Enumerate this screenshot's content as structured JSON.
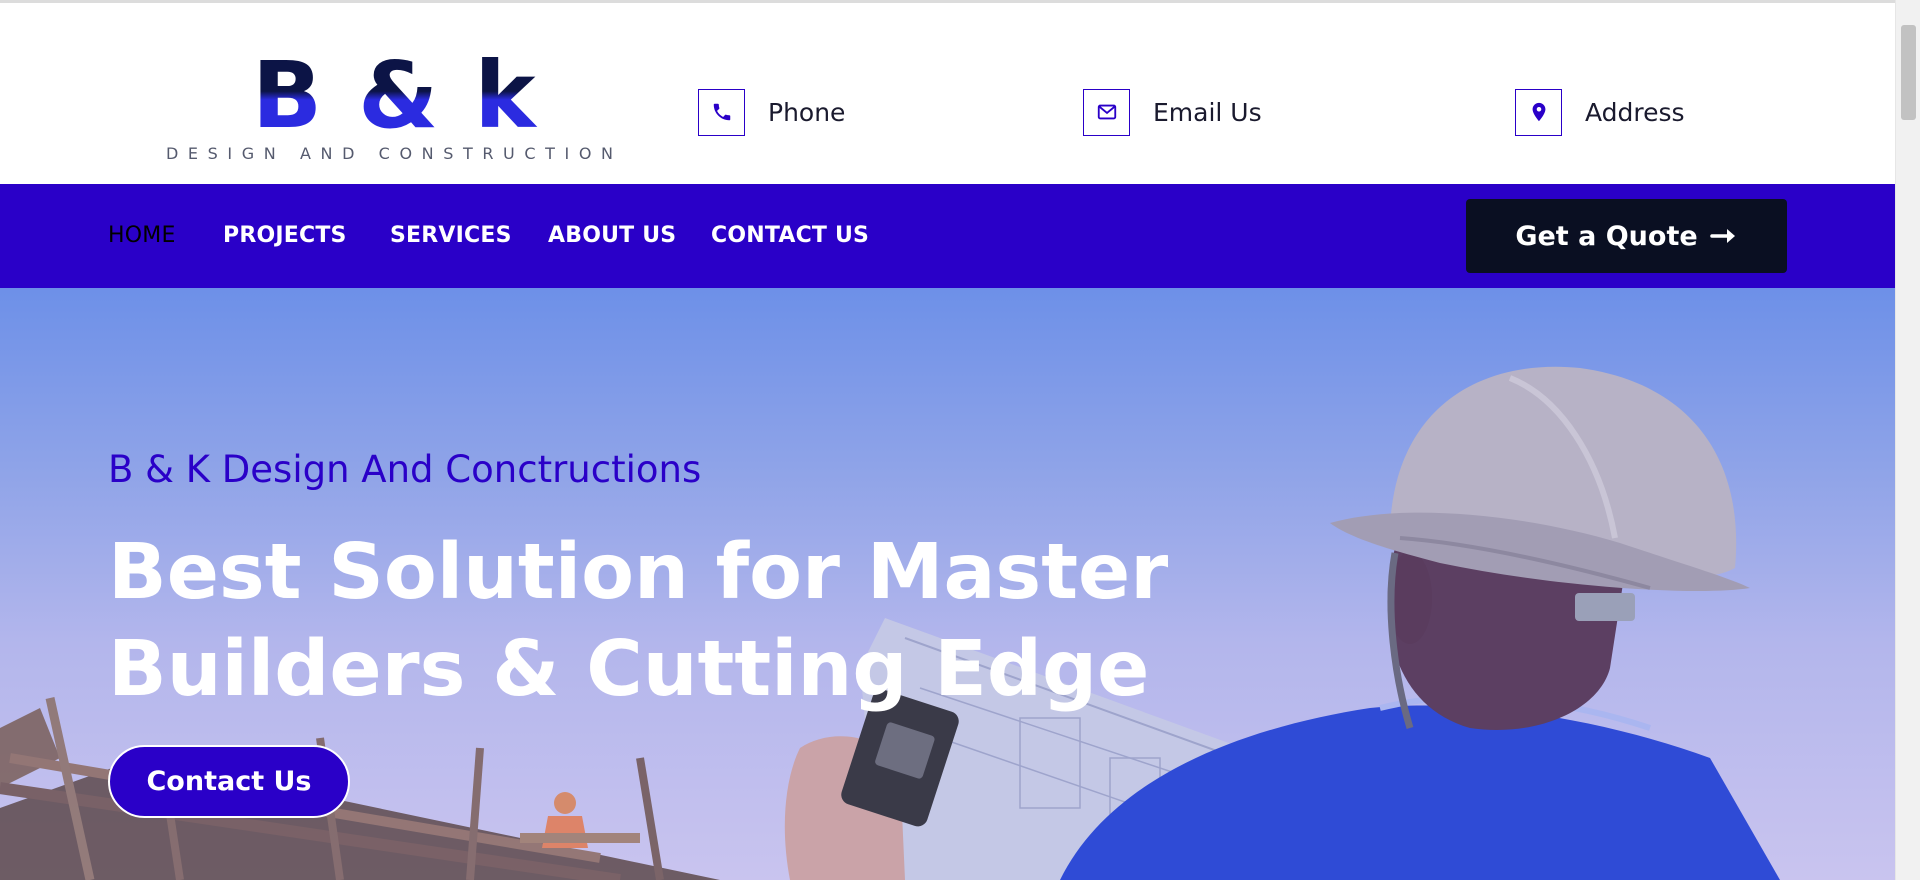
{
  "header": {
    "logo": {
      "mark": "B & k",
      "tagline": "DESIGN AND CONSTRUCTION"
    },
    "contacts": [
      {
        "label": "Phone",
        "icon": "phone-icon"
      },
      {
        "label": "Email Us",
        "icon": "envelope-icon"
      },
      {
        "label": "Address",
        "icon": "map-pin-icon"
      }
    ]
  },
  "nav": {
    "items": [
      {
        "label": "HOME",
        "active": true
      },
      {
        "label": "PROJECTS"
      },
      {
        "label": "SERVICES"
      },
      {
        "label": "ABOUT US"
      },
      {
        "label": "CONTACT US"
      }
    ],
    "quote_button": {
      "label": "Get a Quote",
      "icon": "arrow-right-icon"
    }
  },
  "hero": {
    "subtitle": "B & K Design And Conctructions",
    "title_line1": "Best Solution for Master",
    "title_line2": "Builders & Cutting Edge",
    "cta_label": "Contact Us"
  },
  "colors": {
    "brand": "#2a00c8",
    "dark": "#0a0f22",
    "logo_dark": "#0c1446",
    "logo_blue": "#2b2be0"
  }
}
